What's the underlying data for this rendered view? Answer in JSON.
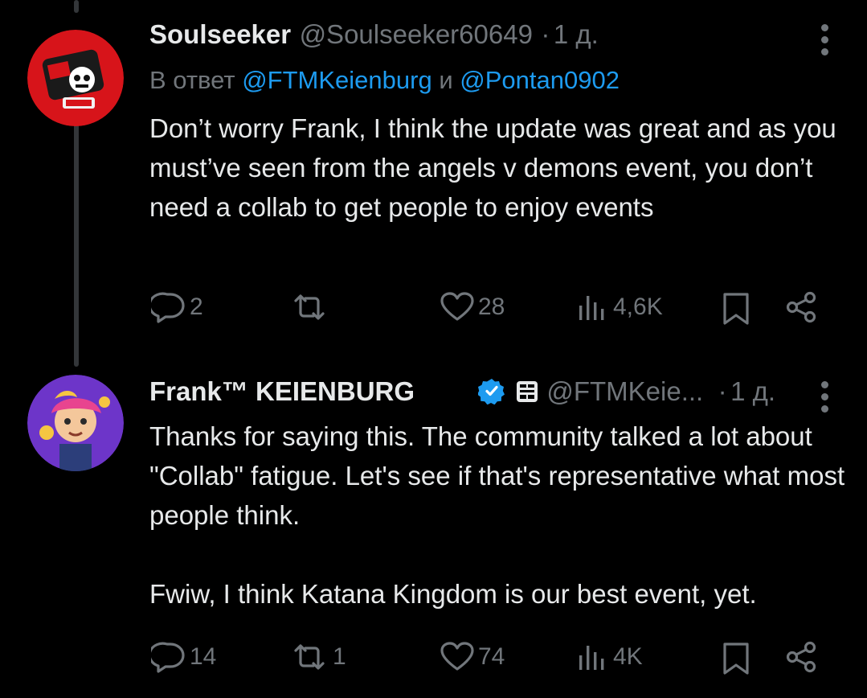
{
  "tweets": [
    {
      "author": "Soulseeker",
      "handle": "@Soulseeker60649",
      "separator": "·",
      "time": "1 д.",
      "reply_prefix": "В ответ",
      "reply_mention_1": "@FTMKeienburg",
      "reply_conjunction": "и",
      "reply_mention_2": "@Pontan0902",
      "text": "Don’t worry Frank, I think the update was great and as you must’ve seen from the angels v demons event, you don’t need a collab to get people to enjoy events",
      "actions": {
        "replies": "2",
        "retweets": "",
        "likes": "28",
        "views": "4,6K"
      },
      "avatar_color": "#d7141a"
    },
    {
      "author": "Frank™ KEIENBURG",
      "handle": "@FTMKeie...",
      "separator": "·",
      "time": "1 д.",
      "verified": true,
      "text_paragraph_1": "Thanks for saying this. The community talked a lot about \"Collab\" fatigue. Let's see if that's representative what most people think.",
      "text_paragraph_2": "Fwiw, I think Katana Kingdom is our best event, yet.",
      "actions": {
        "replies": "14",
        "retweets": "1",
        "likes": "74",
        "views": "4K"
      },
      "avatar_color": "#6d35c9"
    }
  ],
  "colors": {
    "background": "#000000",
    "text_primary": "#e7e9ea",
    "text_secondary": "#71767b",
    "link": "#1d9bf0",
    "verified": "#1d9bf0",
    "thread_line": "#333639"
  },
  "icons": [
    "reply-icon",
    "retweet-icon",
    "like-icon",
    "views-icon",
    "bookmark-icon",
    "share-icon",
    "more-icon",
    "verified-badge-icon",
    "affiliate-badge-icon"
  ]
}
